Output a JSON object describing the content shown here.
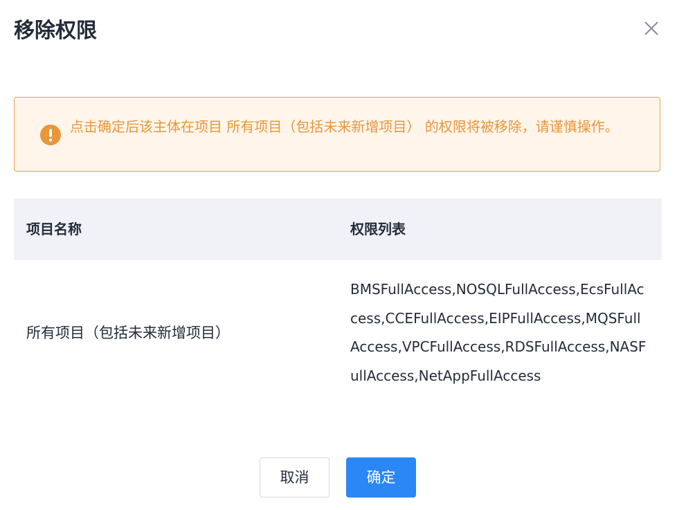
{
  "dialog": {
    "title": "移除权限",
    "close_icon": "close-icon"
  },
  "alert": {
    "icon": "exclamation-circle-icon",
    "text": "点击确定后该主体在项目 所有项目（包括未来新增项目） 的权限将被移除，请谨慎操作。",
    "color": "#e8963a",
    "background": "#fff5ea",
    "border_color": "#e8a04a"
  },
  "table": {
    "headers": {
      "project": "项目名称",
      "permissions": "权限列表"
    },
    "rows": [
      {
        "project": "所有项目（包括未来新增项目）",
        "permissions": "BMSFullAccess,NOSQLFullAccess,EcsFullAccess,CCEFullAccess,EIPFullAccess,MQSFullAccess,VPCFullAccess,RDSFullAccess,NASFullAccess,NetAppFullAccess"
      }
    ]
  },
  "footer": {
    "cancel_label": "取消",
    "confirm_label": "确定",
    "confirm_color": "#2b87f5"
  }
}
